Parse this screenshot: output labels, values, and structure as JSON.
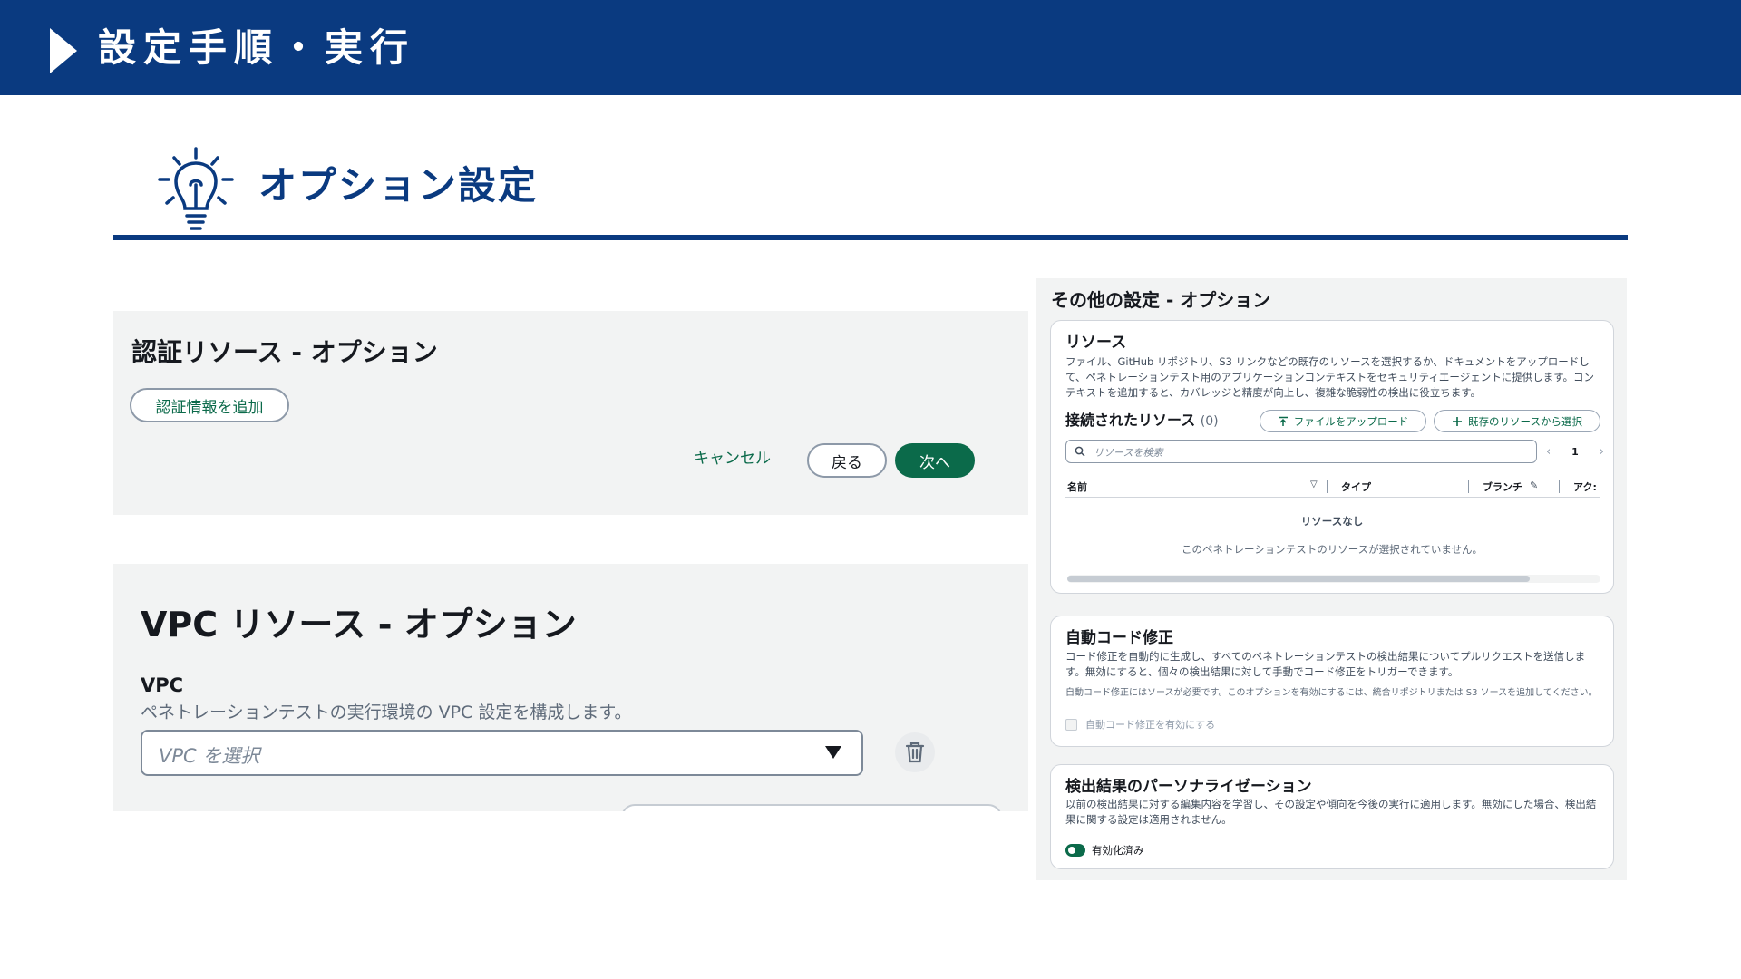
{
  "banner": {
    "title": "設定手順・実行"
  },
  "section": {
    "title": "オプション設定"
  },
  "auth_panel": {
    "title": "認証リソース - オプション",
    "add_button": "認証情報を追加",
    "cancel": "キャンセル",
    "back": "戻る",
    "next": "次へ"
  },
  "vpc_panel": {
    "title": "VPC リソース - オプション",
    "label": "VPC",
    "description": "ペネトレーションテストの実行環境の VPC 設定を構成します。",
    "placeholder": "VPC を選択"
  },
  "other_panel": {
    "title": "その他の設定 - オプション",
    "resources": {
      "heading": "リソース",
      "description": "ファイル、GitHub リポジトリ、S3 リンクなどの既存のリソースを選択するか、ドキュメントをアップロードして、ペネトレーションテスト用のアプリケーションコンテキストをセキュリティエージェントに提供します。コンテキストを追加すると、カバレッジと精度が向上し、複雑な脆弱性の検出に役立ちます。",
      "connected_label": "接続されたリソース",
      "connected_count": "(0)",
      "upload_button": "ファイルをアップロード",
      "choose_button": "既存のリソースから選択",
      "search_placeholder": "リソースを検索",
      "page": "1",
      "columns": [
        "名前",
        "タイプ",
        "ブランチ",
        "アク:"
      ],
      "empty_title": "リソースなし",
      "empty_desc": "このペネトレーションテストのリソースが選択されていません。"
    },
    "autofix": {
      "heading": "自動コード修正",
      "description": "コード修正を自動的に生成し、すべてのペネトレーションテストの検出結果についてプルリクエストを送信します。無効にすると、個々の検出結果に対して手動でコード修正をトリガーできます。",
      "note": "自動コード修正にはソースが必要です。このオプションを有効にするには、統合リポジトリまたは S3 ソースを追加してください。",
      "checkbox_label": "自動コード修正を有効にする"
    },
    "personalization": {
      "heading": "検出結果のパーソナライゼーション",
      "description": "以前の検出結果に対する編集内容を学習し、その設定や傾向を今後の実行に適用します。無効にした場合、検出結果に関する設定は適用されません。",
      "toggle_label": "有効化済み"
    }
  },
  "colors": {
    "navy": "#0a3a80",
    "green": "#0b6a4a",
    "panel": "#f2f3f3"
  }
}
